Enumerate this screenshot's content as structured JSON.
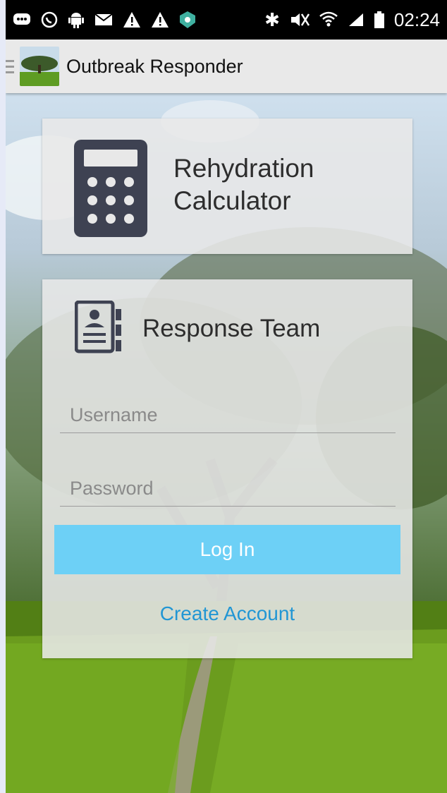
{
  "status_bar": {
    "time": "02:24",
    "left_icons": [
      "message-icon",
      "whatsapp-icon",
      "android-icon",
      "mail-icon",
      "warning-icon",
      "warning-icon",
      "shield-icon"
    ],
    "right_icons": [
      "bluetooth-icon",
      "mute-icon",
      "wifi-icon",
      "signal-icon",
      "battery-icon"
    ]
  },
  "action_bar": {
    "title": "Outbreak Responder"
  },
  "calculator_card": {
    "label": "Rehydration Calculator"
  },
  "login_card": {
    "title": "Response Team",
    "username_placeholder": "Username",
    "password_placeholder": "Password",
    "login_label": "Log In",
    "create_account_label": "Create Account"
  },
  "colors": {
    "accent": "#6dd0f6",
    "link": "#2196d4",
    "icon_dark": "#3e4252"
  }
}
